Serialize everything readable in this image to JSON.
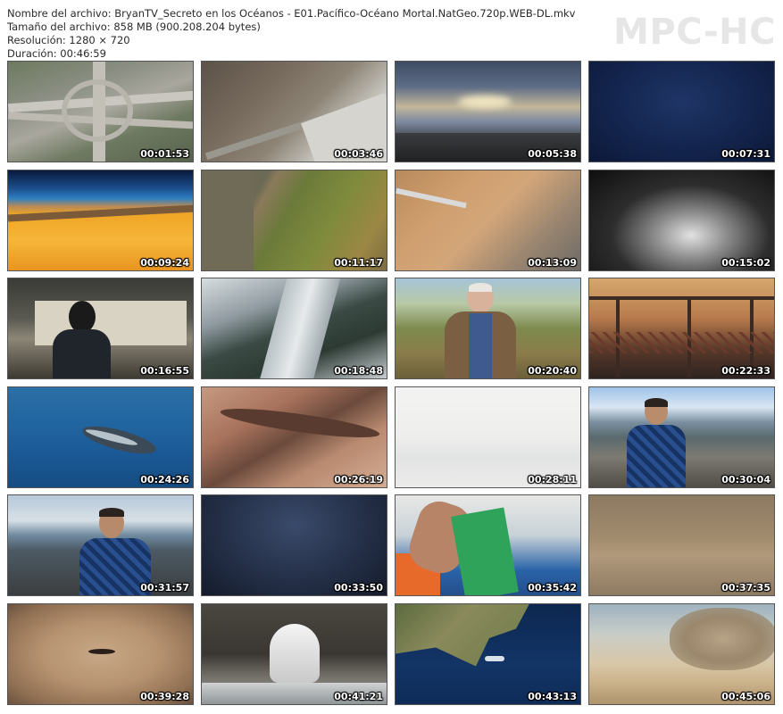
{
  "info": {
    "filename": "Nombre del archivo: BryanTV_Secreto en los Océanos - E01.Pacífico-Océano Mortal.NatGeo.720p.WEB-DL.mkv",
    "filesize": "Tamaño del archivo: 858 MB (900.208.204 bytes)",
    "resolution": "Resolución: 1280 × 720",
    "duration": "Duración: 00:46:59"
  },
  "logo": "MPC-HC",
  "thumbnails": [
    {
      "time": "00:01:53",
      "scene": "highway-interchange-aerial"
    },
    {
      "time": "00:03:46",
      "scene": "tsunami-debris-aerial"
    },
    {
      "time": "00:05:38",
      "scene": "sunset-city-sky"
    },
    {
      "time": "00:07:31",
      "scene": "dark-ocean-water"
    },
    {
      "time": "00:09:24",
      "scene": "earth-mantle-cutaway"
    },
    {
      "time": "00:11:17",
      "scene": "coastal-forest-aerial"
    },
    {
      "time": "00:13:09",
      "scene": "sediment-core-sample"
    },
    {
      "time": "00:15:02",
      "scene": "ice-crystals-closeup"
    },
    {
      "time": "00:16:55",
      "scene": "man-with-documents"
    },
    {
      "time": "00:18:48",
      "scene": "snowy-forest-river"
    },
    {
      "time": "00:20:40",
      "scene": "scientist-speaking-field"
    },
    {
      "time": "00:22:33",
      "scene": "bridge-at-dusk"
    },
    {
      "time": "00:24:26",
      "scene": "humpback-whale-underwater"
    },
    {
      "time": "00:26:19",
      "scene": "eroded-terrain-aerial"
    },
    {
      "time": "00:28:11",
      "scene": "hazy-white-sky"
    },
    {
      "time": "00:30:04",
      "scene": "host-rocky-shore"
    },
    {
      "time": "00:31:57",
      "scene": "host-sitting-beach"
    },
    {
      "time": "00:33:50",
      "scene": "dark-stormy-sky"
    },
    {
      "time": "00:35:42",
      "scene": "tattooed-arm-net"
    },
    {
      "time": "00:37:35",
      "scene": "brown-haze"
    },
    {
      "time": "00:39:28",
      "scene": "desert-crater"
    },
    {
      "time": "00:41:21",
      "scene": "sea-arch-waves"
    },
    {
      "time": "00:43:13",
      "scene": "satellite-map-japan"
    },
    {
      "time": "00:45:06",
      "scene": "dust-explosion-desert"
    }
  ]
}
